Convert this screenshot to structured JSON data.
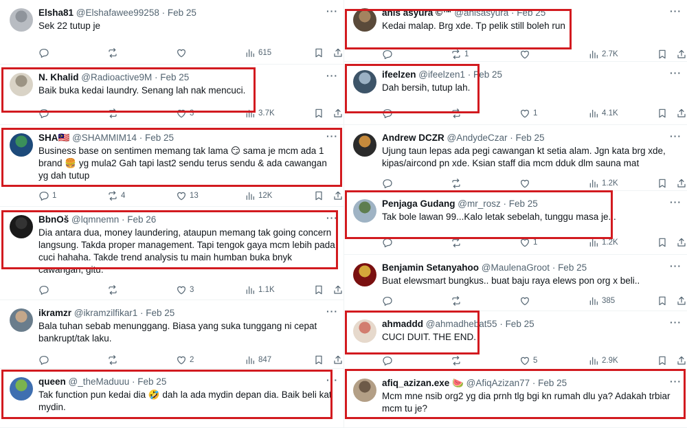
{
  "left_tweets": [
    {
      "name": "Elsha81",
      "handle": "@Elshafawee99258",
      "date": "Feb 25",
      "text": "Sek 22 tutup je",
      "replies": "",
      "reposts": "",
      "likes": "",
      "views": "615"
    },
    {
      "name": "N. Khalid",
      "handle": "@Radioactive9M",
      "date": "Feb 25",
      "text": "Baik buka kedai laundry. Senang lah nak mencuci.",
      "replies": "",
      "reposts": "",
      "likes": "3",
      "views": "3.7K"
    },
    {
      "name": "SHA🇲🇾",
      "handle": "@SHAMMIM14",
      "date": "Feb 25",
      "text": "Business base on sentimen memang tak lama 😏 sama je mcm ada 1 brand 🍔 yg mula2 Gah tapi last2 sendu terus sendu & ada cawangan yg dah tutup",
      "replies": "1",
      "reposts": "4",
      "likes": "13",
      "views": "12K"
    },
    {
      "name": "BbnOš",
      "handle": "@lqmnemn",
      "date": "Feb 26",
      "text": "Dia antara dua, money laundering, ataupun memang tak going concern langsung. Takda proper management. Tapi tengok gaya mcm lebih pada cuci hahaha. Takde trend analysis tu main humban buka bnyk cawangan, gitu.",
      "replies": "",
      "reposts": "",
      "likes": "3",
      "views": "1.1K"
    },
    {
      "name": "ikramzr",
      "handle": "@ikramzilfikar1",
      "date": "Feb 25",
      "text": "Bala tuhan sebab menunggang. Biasa yang suka tunggang ni cepat bankrupt/tak laku.",
      "replies": "",
      "reposts": "",
      "likes": "2",
      "views": "847"
    },
    {
      "name": "queen",
      "handle": "@_theMaduuu",
      "date": "Feb 25",
      "text": "Tak function pun kedai dia 🤣 dah la ada mydin depan dia. Baik beli kat mydin.",
      "replies": "",
      "reposts": "",
      "likes": "",
      "views": ""
    }
  ],
  "right_tweets": [
    {
      "name": "anis asyura ©™",
      "handle": "@anisasyura",
      "date": "Feb 25",
      "text": "Kedai malap. Brg xde. Tp pelik still boleh run",
      "replies": "",
      "reposts": "1",
      "likes": "",
      "views": "2.7K"
    },
    {
      "name": "ifeelzen",
      "handle": "@ifeelzen1",
      "date": "Feb 25",
      "text": "Dah bersih, tutup lah.",
      "replies": "",
      "reposts": "",
      "likes": "1",
      "views": "4.1K"
    },
    {
      "name": "Andrew DCZR",
      "handle": "@AndydeCzar",
      "date": "Feb 25",
      "text": "Ujung taun lepas ada pegi cawangan kt setia alam. Jgn kata brg xde, kipas/aircond pn xde. Ksian staff dia mcm dduk dlm sauna mat",
      "replies": "",
      "reposts": "",
      "likes": "",
      "views": "1.2K"
    },
    {
      "name": "Penjaga Gudang",
      "handle": "@mr_rosz",
      "date": "Feb 25",
      "text": "Tak bole lawan 99...Kalo letak sebelah, tunggu masa je...",
      "replies": "",
      "reposts": "",
      "likes": "1",
      "views": "1.2K"
    },
    {
      "name": "Benjamin Setanyahoo",
      "handle": "@MaulenaGroot",
      "date": "Feb 25",
      "text": "Buat elewsmart bungkus.. buat baju raya elews pon org x beli..",
      "replies": "",
      "reposts": "",
      "likes": "",
      "views": "385"
    },
    {
      "name": "ahmaddd",
      "handle": "@ahmadhebat55",
      "date": "Feb 25",
      "text": "CUCI DUIT. THE END.",
      "replies": "",
      "reposts": "",
      "likes": "5",
      "views": "2.9K"
    },
    {
      "name": "afiq_azizan.exe 🍉",
      "handle": "@AfiqAzizan77",
      "date": "Feb 25",
      "text": "Mcm mne nsib org2 yg dia prnh tlg bgi kn rumah dlu ya? Adakah trbiar mcm tu je?",
      "replies": "",
      "reposts": "",
      "likes": "",
      "views": ""
    }
  ],
  "colors": {
    "highlight": "#d21a1f",
    "text": "#0f1419",
    "muted": "#536471",
    "divider": "#eff3f4"
  },
  "icons": [
    "more-icon",
    "reply-icon",
    "repost-icon",
    "like-icon",
    "views-icon",
    "bookmark-icon",
    "share-icon"
  ]
}
